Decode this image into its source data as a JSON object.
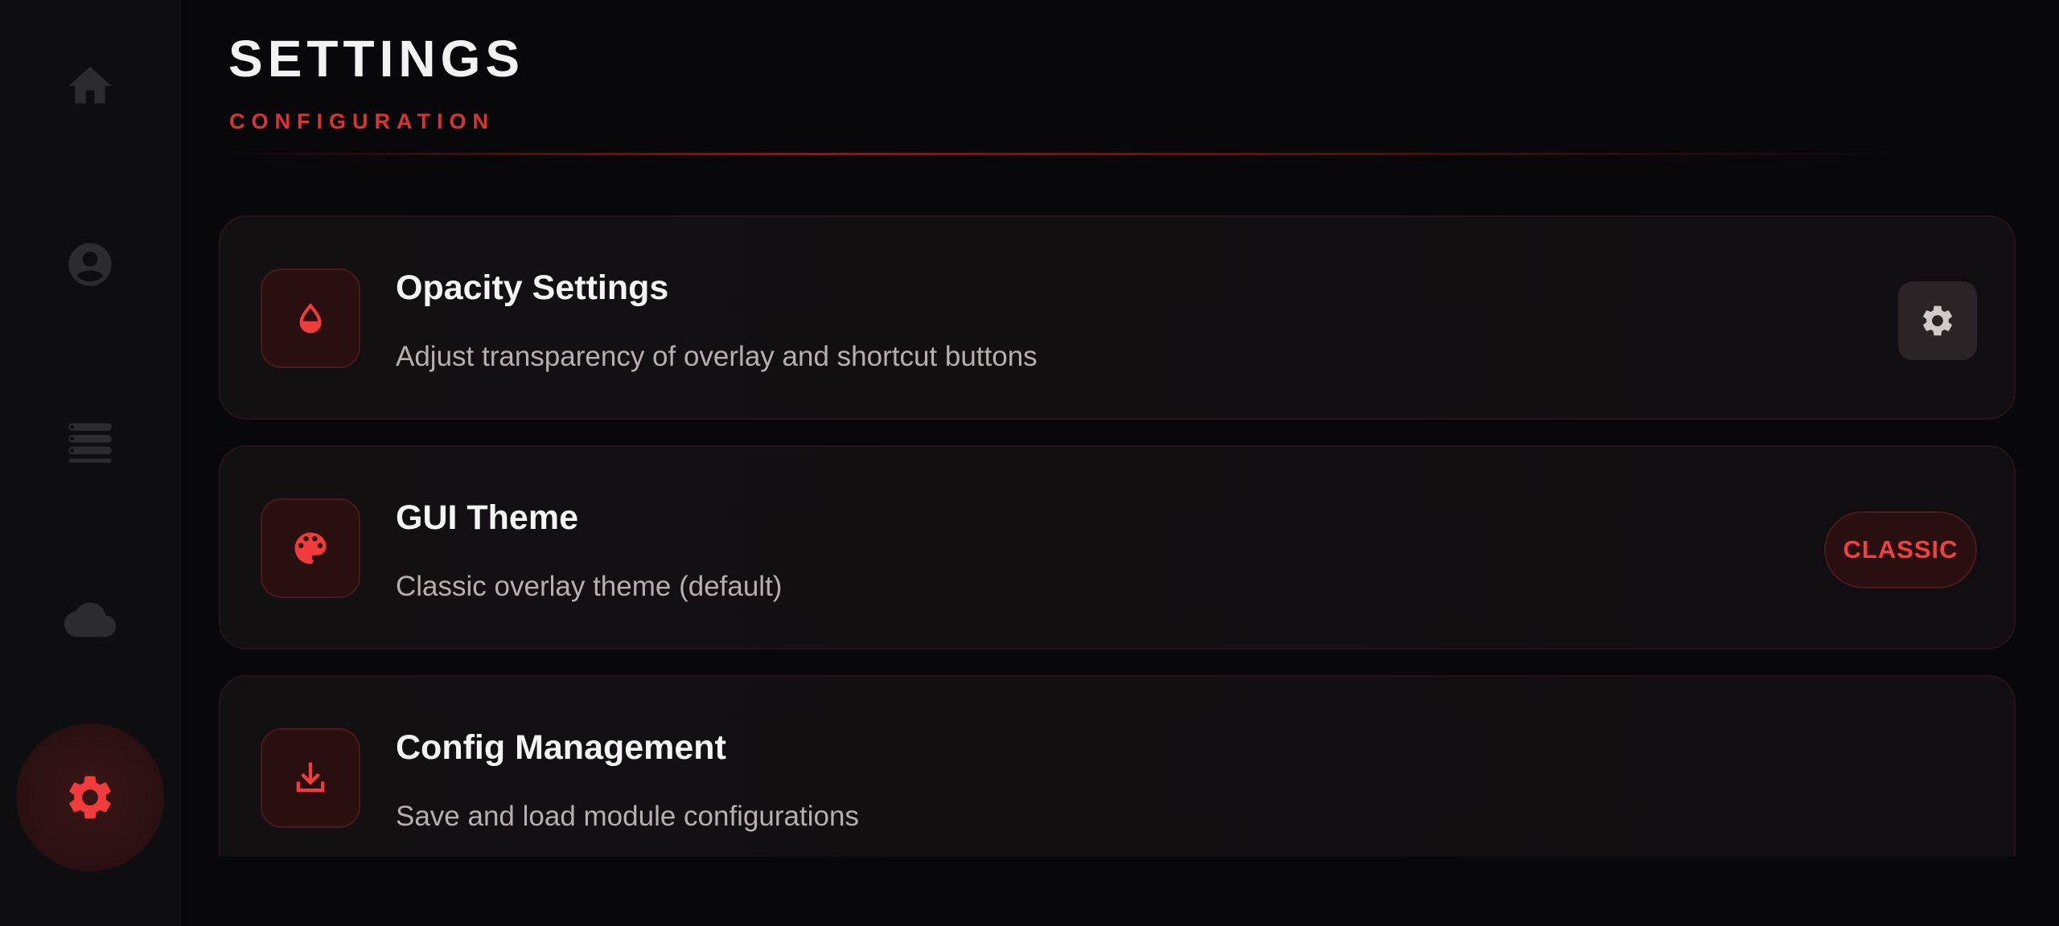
{
  "header": {
    "title": "SETTINGS",
    "subtitle": "CONFIGURATION"
  },
  "sidebar": {
    "items": [
      {
        "icon": "home-icon",
        "active": false
      },
      {
        "icon": "profile-icon",
        "active": false
      },
      {
        "icon": "modules-icon",
        "active": false
      },
      {
        "icon": "cloud-icon",
        "active": false
      },
      {
        "icon": "settings-gear-icon",
        "active": true
      }
    ]
  },
  "settings": [
    {
      "icon": "opacity-drop-icon",
      "title": "Opacity Settings",
      "description": "Adjust transparency of overlay and shortcut buttons",
      "action": {
        "type": "icon-button",
        "icon": "gear-icon"
      }
    },
    {
      "icon": "palette-icon",
      "title": "GUI Theme",
      "description": "Classic overlay theme (default)",
      "action": {
        "type": "pill",
        "label": "CLASSIC"
      }
    },
    {
      "icon": "download-icon",
      "title": "Config Management",
      "description": "Save and load module configurations"
    }
  ],
  "colors": {
    "accent": "#f23b3b",
    "background": "#08080a",
    "card": "#121012",
    "sidebar": "#0e0e10"
  }
}
